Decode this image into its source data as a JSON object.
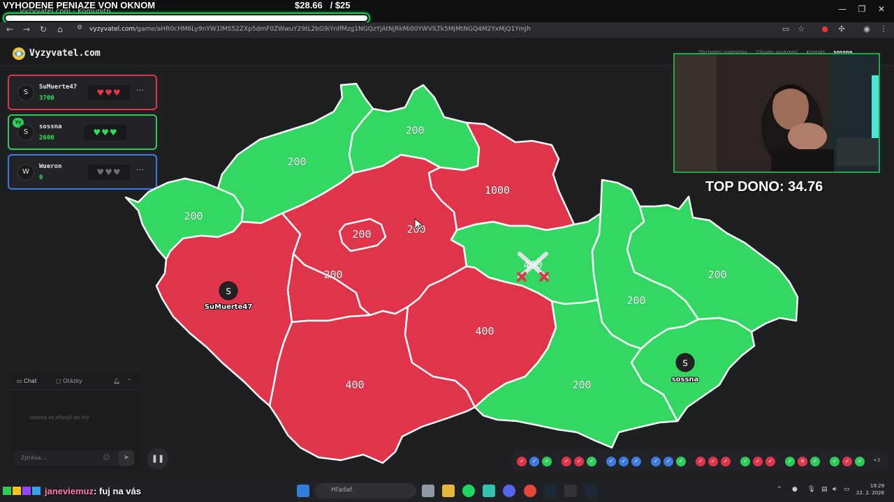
{
  "browser": {
    "tab_title": "Vyzyvatel.com - Komunitn",
    "url_domain": "vyzyvatel.com",
    "url_path": "/game/aHR0cHM6Ly9nYW1lMS52ZXp5dmF0ZWwuY29tL2bG9iYnlfMzg1NGQzYjAtNjRkMi00YWVlLTk5MjMtNGQ4M2YxMjQ1YmJh"
  },
  "overlay": {
    "title": "VYHODENE PENIAZE VON OKNOM",
    "goal_text": "$28.66   / $25",
    "goal_progress": 1.0,
    "top_dono": "TOP DONO: 34.76"
  },
  "app": {
    "logo_text": "Vyzyvatel.com",
    "links": [
      "Obchodní podmínky",
      "Zásady soukromí",
      "Kontakt",
      "sossna"
    ],
    "user_initial": "S"
  },
  "players": [
    {
      "initial": "S",
      "name": "SuMuerte47",
      "score": "3700",
      "hearts": [
        "red",
        "red",
        "red"
      ],
      "border": "#e0354a",
      "you": false,
      "more": "···"
    },
    {
      "initial": "S",
      "name": "sossna",
      "score": "2600",
      "hearts": [
        "green",
        "green",
        "green"
      ],
      "border": "#2ecc5a",
      "you": true,
      "you_label": "Vy"
    },
    {
      "initial": "W",
      "name": "Wueron",
      "score": "0",
      "hearts": [
        "gray",
        "gray",
        "gray"
      ],
      "border": "#3d7be0",
      "you": false,
      "more": "···"
    }
  ],
  "map": {
    "colors": {
      "red": "#e0344a",
      "green": "#33d863",
      "border": "#ffffff"
    },
    "regions": [
      {
        "id": "karlovarsky",
        "owner": "green",
        "value": "200"
      },
      {
        "id": "ustecky",
        "owner": "green",
        "value": "200"
      },
      {
        "id": "liberecky",
        "owner": "green",
        "value": "200"
      },
      {
        "id": "kralovehradecky",
        "owner": "red",
        "value": "1000"
      },
      {
        "id": "stredocesky",
        "owner": "red",
        "value": "200"
      },
      {
        "id": "praha",
        "owner": "red",
        "value": "200"
      },
      {
        "id": "plzensky",
        "owner": "red",
        "value": ""
      },
      {
        "id": "jihocesky",
        "owner": "red",
        "value": "400"
      },
      {
        "id": "pardubicky",
        "owner": "green",
        "value": "400"
      },
      {
        "id": "vysocina",
        "owner": "red",
        "value": "400"
      },
      {
        "id": "jihomoravsky",
        "owner": "green",
        "value": "200"
      },
      {
        "id": "olomoucky",
        "owner": "green",
        "value": "200"
      },
      {
        "id": "moravskoslezsky",
        "owner": "green",
        "value": "200"
      },
      {
        "id": "zlinsky",
        "owner": "green",
        "value": ""
      },
      {
        "id": "west-middle",
        "owner": "red",
        "value": "200"
      }
    ],
    "markers": [
      {
        "initial": "S",
        "name": "SuMuerte47"
      },
      {
        "initial": "S",
        "name": "sossna"
      }
    ]
  },
  "chat": {
    "tab_chat": "Chat",
    "tab_questions": "Otázky",
    "message": "sossna se připojil do hry",
    "input_placeholder": "Zpráva..."
  },
  "history": {
    "groups": [
      [
        "red",
        "blue",
        "green"
      ],
      [
        "red",
        "red",
        "green"
      ],
      [
        "blue",
        "blue",
        "blue"
      ],
      [
        "blue",
        "blue",
        "green"
      ],
      [
        "red",
        "red",
        "red"
      ],
      [
        "green",
        "red",
        "red"
      ],
      [
        "green",
        "red-x",
        "green"
      ],
      [
        "green",
        "red",
        "green"
      ]
    ],
    "more": "+3"
  },
  "twitch": {
    "user": "janeviemuz",
    "message": ": fuj na vás"
  },
  "taskbar": {
    "search": "Hľadať",
    "time": "19:29",
    "date": "22. 2. 2026"
  }
}
